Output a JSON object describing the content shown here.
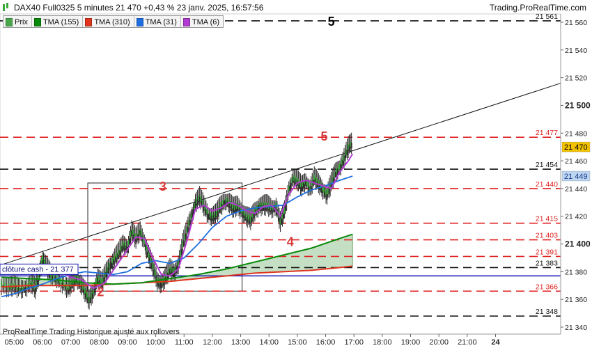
{
  "header": {
    "title": "DAX40 Full0325 5 minutes 21 470 +0,43 % 23 janv. 2025, 16:57:56",
    "brand": "Trading.ProRealTime.com"
  },
  "legend": [
    {
      "label": "Prix",
      "color": "#49a64a"
    },
    {
      "label": "TMA (155)",
      "color": "#0a8a0a"
    },
    {
      "label": "TMA (310)",
      "color": "#e0341e"
    },
    {
      "label": "TMA (31)",
      "color": "#1e6ee0"
    },
    {
      "label": "TMA (6)",
      "color": "#b23ccf"
    }
  ],
  "footer": "ProRealTime Trading  Historique ajusté aux rollovers",
  "chart_data": {
    "type": "line",
    "x_tick_labels": [
      "05:00",
      "06:00",
      "07:00",
      "08:00",
      "09:00",
      "10:00",
      "11:00",
      "12:00",
      "13:00",
      "14:00",
      "15:00",
      "16:00",
      "17:00",
      "18:00",
      "19:00",
      "20:00",
      "21:00",
      "24"
    ],
    "y_ticks": [
      "21 340",
      "21 360",
      "21 380",
      "21 400",
      "21 420",
      "21 440",
      "21 460",
      "21 480",
      "21 500",
      "21 520",
      "21 540",
      "21 560"
    ],
    "y_major": [
      "21 400",
      "21 500"
    ],
    "ylim": [
      21335,
      21566
    ],
    "xlim_hours": [
      4.5,
      24.3
    ],
    "price": [
      [
        4.55,
        21371
      ],
      [
        4.8,
        21369
      ],
      [
        5.0,
        21370
      ],
      [
        5.2,
        21368
      ],
      [
        5.4,
        21369
      ],
      [
        5.6,
        21372
      ],
      [
        5.75,
        21368
      ],
      [
        5.9,
        21380
      ],
      [
        6.0,
        21390
      ],
      [
        6.15,
        21384
      ],
      [
        6.3,
        21378
      ],
      [
        6.5,
        21376
      ],
      [
        6.7,
        21372
      ],
      [
        6.9,
        21368
      ],
      [
        7.05,
        21372
      ],
      [
        7.2,
        21376
      ],
      [
        7.35,
        21372
      ],
      [
        7.5,
        21366
      ],
      [
        7.65,
        21360
      ],
      [
        7.8,
        21366
      ],
      [
        7.95,
        21376
      ],
      [
        8.1,
        21372
      ],
      [
        8.25,
        21380
      ],
      [
        8.4,
        21386
      ],
      [
        8.55,
        21390
      ],
      [
        8.7,
        21394
      ],
      [
        8.85,
        21400
      ],
      [
        9.0,
        21398
      ],
      [
        9.15,
        21410
      ],
      [
        9.3,
        21404
      ],
      [
        9.45,
        21410
      ],
      [
        9.6,
        21402
      ],
      [
        9.75,
        21392
      ],
      [
        9.9,
        21384
      ],
      [
        10.05,
        21374
      ],
      [
        10.2,
        21372
      ],
      [
        10.35,
        21376
      ],
      [
        10.5,
        21382
      ],
      [
        10.65,
        21380
      ],
      [
        10.8,
        21386
      ],
      [
        10.95,
        21400
      ],
      [
        11.1,
        21410
      ],
      [
        11.25,
        21420
      ],
      [
        11.4,
        21430
      ],
      [
        11.55,
        21434
      ],
      [
        11.7,
        21428
      ],
      [
        11.85,
        21422
      ],
      [
        12.0,
        21420
      ],
      [
        12.15,
        21422
      ],
      [
        12.3,
        21428
      ],
      [
        12.45,
        21432
      ],
      [
        12.6,
        21430
      ],
      [
        12.75,
        21426
      ],
      [
        12.9,
        21428
      ],
      [
        13.05,
        21424
      ],
      [
        13.2,
        21420
      ],
      [
        13.35,
        21418
      ],
      [
        13.5,
        21424
      ],
      [
        13.65,
        21428
      ],
      [
        13.8,
        21428
      ],
      [
        13.95,
        21428
      ],
      [
        14.1,
        21426
      ],
      [
        14.25,
        21428
      ],
      [
        14.4,
        21416
      ],
      [
        14.55,
        21424
      ],
      [
        14.7,
        21440
      ],
      [
        14.85,
        21448
      ],
      [
        15.0,
        21446
      ],
      [
        15.15,
        21442
      ],
      [
        15.3,
        21446
      ],
      [
        15.45,
        21440
      ],
      [
        15.6,
        21448
      ],
      [
        15.75,
        21444
      ],
      [
        15.9,
        21440
      ],
      [
        16.05,
        21436
      ],
      [
        16.2,
        21444
      ],
      [
        16.35,
        21452
      ],
      [
        16.5,
        21456
      ],
      [
        16.65,
        21462
      ],
      [
        16.8,
        21470
      ],
      [
        16.95,
        21474
      ]
    ],
    "series": [
      {
        "name": "TMA (6)",
        "color": "#b23ccf",
        "points": [
          [
            6.1,
            21384
          ],
          [
            6.5,
            21382
          ],
          [
            7.0,
            21376
          ],
          [
            7.4,
            21374
          ],
          [
            7.8,
            21368
          ],
          [
            8.2,
            21372
          ],
          [
            8.6,
            21384
          ],
          [
            9.0,
            21396
          ],
          [
            9.3,
            21405
          ],
          [
            9.6,
            21404
          ],
          [
            9.9,
            21390
          ],
          [
            10.2,
            21378
          ],
          [
            10.5,
            21377
          ],
          [
            10.8,
            21382
          ],
          [
            11.1,
            21402
          ],
          [
            11.4,
            21425
          ],
          [
            11.7,
            21428
          ],
          [
            12.0,
            21424
          ],
          [
            12.3,
            21426
          ],
          [
            12.6,
            21430
          ],
          [
            12.9,
            21428
          ],
          [
            13.2,
            21424
          ],
          [
            13.5,
            21422
          ],
          [
            13.8,
            21427
          ],
          [
            14.1,
            21428
          ],
          [
            14.4,
            21420
          ],
          [
            14.7,
            21436
          ],
          [
            15.0,
            21444
          ],
          [
            15.3,
            21446
          ],
          [
            15.6,
            21444
          ],
          [
            15.9,
            21442
          ],
          [
            16.2,
            21440
          ],
          [
            16.5,
            21452
          ],
          [
            16.8,
            21460
          ],
          [
            16.95,
            21465
          ]
        ]
      },
      {
        "name": "TMA (31)",
        "color": "#1e6ee0",
        "points": [
          [
            4.55,
            21362
          ],
          [
            5.0,
            21364
          ],
          [
            5.5,
            21368
          ],
          [
            6.0,
            21371
          ],
          [
            6.5,
            21375
          ],
          [
            7.0,
            21378
          ],
          [
            7.5,
            21380
          ],
          [
            8.0,
            21379
          ],
          [
            8.5,
            21378
          ],
          [
            9.0,
            21380
          ],
          [
            9.5,
            21386
          ],
          [
            10.0,
            21388
          ],
          [
            10.5,
            21386
          ],
          [
            11.0,
            21390
          ],
          [
            11.5,
            21400
          ],
          [
            12.0,
            21412
          ],
          [
            12.5,
            21420
          ],
          [
            13.0,
            21424
          ],
          [
            13.5,
            21426
          ],
          [
            14.0,
            21427
          ],
          [
            14.5,
            21428
          ],
          [
            15.0,
            21434
          ],
          [
            15.5,
            21439
          ],
          [
            16.0,
            21442
          ],
          [
            16.5,
            21446
          ],
          [
            16.95,
            21449
          ]
        ]
      },
      {
        "name": "TMA (155)",
        "color": "#0a8a0a",
        "points": [
          [
            4.55,
            21376
          ],
          [
            5.5,
            21375
          ],
          [
            6.5,
            21374
          ],
          [
            7.5,
            21372
          ],
          [
            8.5,
            21371
          ],
          [
            9.5,
            21372
          ],
          [
            10.5,
            21375
          ],
          [
            11.5,
            21378
          ],
          [
            12.5,
            21382
          ],
          [
            13.5,
            21387
          ],
          [
            14.5,
            21392
          ],
          [
            15.5,
            21397
          ],
          [
            16.5,
            21404
          ],
          [
            16.95,
            21407
          ]
        ]
      },
      {
        "name": "TMA (310)",
        "color": "#e0341e",
        "points": [
          [
            4.55,
            21369
          ],
          [
            5.5,
            21370
          ],
          [
            6.5,
            21370
          ],
          [
            7.5,
            21370
          ],
          [
            8.5,
            21371
          ],
          [
            9.5,
            21372
          ],
          [
            10.5,
            21373
          ],
          [
            11.5,
            21375
          ],
          [
            12.5,
            21377
          ],
          [
            13.5,
            21379
          ],
          [
            14.5,
            21380
          ],
          [
            15.5,
            21381
          ],
          [
            16.5,
            21383
          ],
          [
            16.95,
            21384
          ]
        ]
      }
    ],
    "hlines": [
      {
        "value": 21561,
        "label": "21 561",
        "style": "black"
      },
      {
        "value": 21477,
        "label": "21 477",
        "style": "red"
      },
      {
        "value": 21454,
        "label": "21 454",
        "style": "black"
      },
      {
        "value": 21440,
        "label": "21 440",
        "style": "red"
      },
      {
        "value": 21415,
        "label": "21 415",
        "style": "red"
      },
      {
        "value": 21403,
        "label": "21 403",
        "style": "red"
      },
      {
        "value": 21391,
        "label": "21 391",
        "style": "red"
      },
      {
        "value": 21383,
        "label": "21 383",
        "style": "black"
      },
      {
        "value": 21366,
        "label": "21 366",
        "style": "red"
      },
      {
        "value": 21348,
        "label": "21 348",
        "style": "black"
      }
    ],
    "cash_close": {
      "value": 21377,
      "label": "clôture cash -  21 377"
    },
    "trendlines": [
      {
        "from": [
          4.55,
          21385
        ],
        "to": [
          24.3,
          21516
        ]
      }
    ],
    "rectangle": {
      "x": [
        7.6,
        13.05
      ],
      "y": [
        21366,
        21444
      ]
    },
    "annotations": [
      {
        "text": "5",
        "x": 16.2,
        "y": 21561,
        "color": "#000000"
      },
      {
        "text": "5",
        "x": 15.95,
        "y": 21478,
        "color": "#d83a3a"
      },
      {
        "text": "3",
        "x": 10.25,
        "y": 21442,
        "color": "#d83a3a"
      },
      {
        "text": "4",
        "x": 14.75,
        "y": 21402,
        "color": "#d83a3a"
      },
      {
        "text": "2",
        "x": 8.05,
        "y": 21366,
        "color": "#d83a3a"
      }
    ],
    "price_tags": [
      {
        "value": 21470,
        "label": "21 470",
        "bg": "#f2c200",
        "color": "#000000"
      },
      {
        "value": 21449,
        "label": "21 449",
        "bg": "#bcd6f2",
        "color": "#1a3a8a"
      }
    ]
  }
}
